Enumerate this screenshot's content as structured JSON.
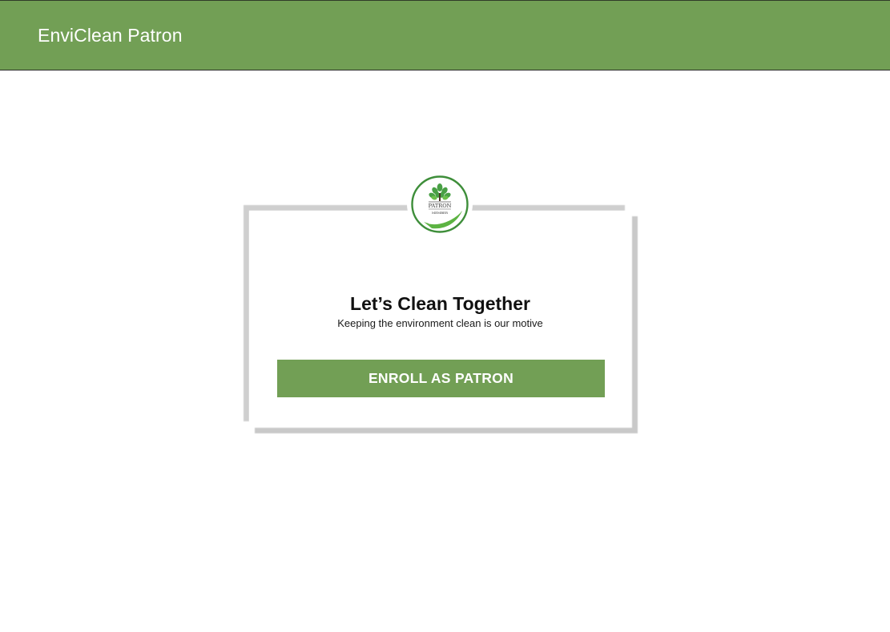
{
  "app_bar": {
    "title": "EnviClean Patron",
    "color": "#729f55"
  },
  "card": {
    "badge": {
      "icon": "tree-badge-icon",
      "line1": "PATRON",
      "line2": "MEMBER",
      "ring_color": "#3e8e3a"
    },
    "headline": "Let’s Clean Together",
    "subline": "Keeping the environment clean is our motive",
    "button_label": "ENROLL AS PATRON"
  }
}
